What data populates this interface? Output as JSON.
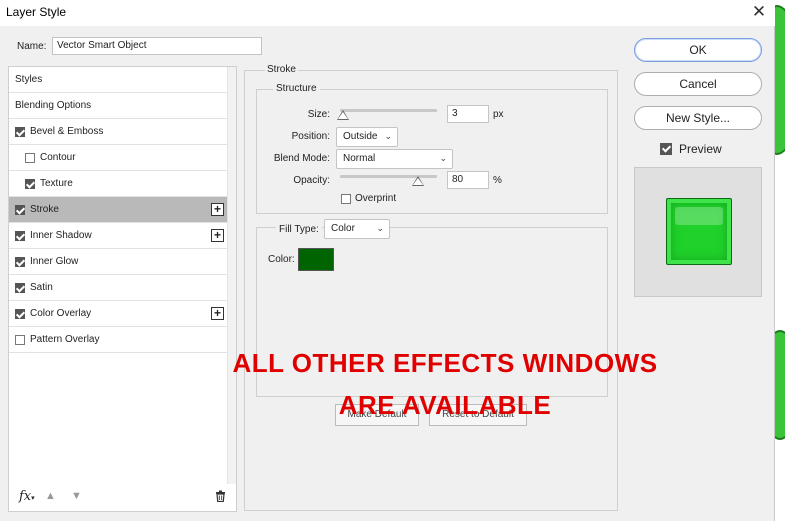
{
  "window": {
    "title": "Layer Style",
    "close_glyph": "✕"
  },
  "name_field": {
    "label": "Name:",
    "value": "Vector Smart Object"
  },
  "styles_list": [
    {
      "label": "Styles",
      "checkbox": false,
      "checked": false,
      "indent": false,
      "plus": false,
      "selected": false
    },
    {
      "label": "Blending Options",
      "checkbox": false,
      "checked": false,
      "indent": false,
      "plus": false,
      "selected": false
    },
    {
      "label": "Bevel & Emboss",
      "checkbox": true,
      "checked": true,
      "indent": false,
      "plus": false,
      "selected": false
    },
    {
      "label": "Contour",
      "checkbox": true,
      "checked": false,
      "indent": true,
      "plus": false,
      "selected": false
    },
    {
      "label": "Texture",
      "checkbox": true,
      "checked": true,
      "indent": true,
      "plus": false,
      "selected": false
    },
    {
      "label": "Stroke",
      "checkbox": true,
      "checked": true,
      "indent": false,
      "plus": true,
      "selected": true
    },
    {
      "label": "Inner Shadow",
      "checkbox": true,
      "checked": true,
      "indent": false,
      "plus": true,
      "selected": false
    },
    {
      "label": "Inner Glow",
      "checkbox": true,
      "checked": true,
      "indent": false,
      "plus": false,
      "selected": false
    },
    {
      "label": "Satin",
      "checkbox": true,
      "checked": true,
      "indent": false,
      "plus": false,
      "selected": false
    },
    {
      "label": "Color Overlay",
      "checkbox": true,
      "checked": true,
      "indent": false,
      "plus": true,
      "selected": false
    },
    {
      "label": "Pattern Overlay",
      "checkbox": true,
      "checked": false,
      "indent": false,
      "plus": false,
      "selected": false
    }
  ],
  "footer": {
    "fx": "fx",
    "fx_suffix": "▾"
  },
  "stroke": {
    "section_title": "Stroke",
    "structure_title": "Structure",
    "size_label": "Size:",
    "size_value": "3",
    "size_unit": "px",
    "position_label": "Position:",
    "position_value": "Outside",
    "blend_label": "Blend Mode:",
    "blend_value": "Normal",
    "opacity_label": "Opacity:",
    "opacity_value": "80",
    "opacity_unit": "%",
    "overprint_label": "Overprint",
    "fill_type_label": "Fill Type:",
    "fill_type_value": "Color",
    "color_label": "Color:",
    "stroke_color": "#006400"
  },
  "under_buttons": {
    "make_default": "Make Default",
    "reset_default": "Reset to Default"
  },
  "overlay_text": {
    "line1": "ALL OTHER EFFECTS WINDOWS",
    "line2": "ARE AVAILABLE"
  },
  "right_buttons": {
    "ok": "OK",
    "cancel": "Cancel",
    "new_style": "New Style..."
  },
  "preview": {
    "label": "Preview",
    "checked": true,
    "swatch_color": "#1fd12a"
  },
  "icons": {
    "close": "close-icon",
    "fx": "fx-icon",
    "up": "arrow-up-icon",
    "down": "arrow-down-icon",
    "trash": "trash-icon",
    "plus": "plus-icon",
    "chevron": "chevron-down-icon"
  }
}
